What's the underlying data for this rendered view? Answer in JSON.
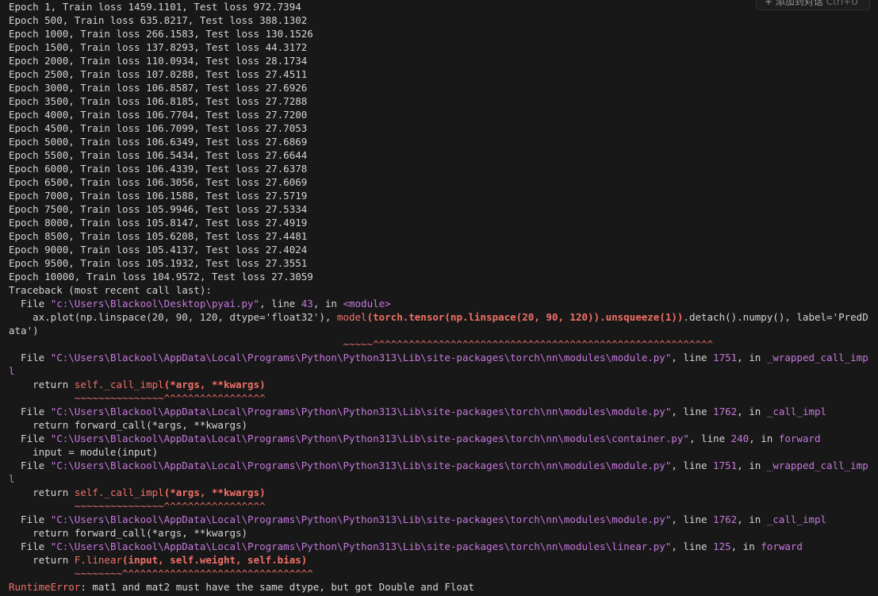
{
  "chat_chip": {
    "icon": "plus-icon",
    "label": "添加到对话",
    "shortcut": "Ctrl+U"
  },
  "epochs": [
    "Epoch 1, Train loss 1459.1101, Test loss 972.7394",
    "Epoch 500, Train loss 635.8217, Test loss 388.1302",
    "Epoch 1000, Train loss 266.1583, Test loss 130.1526",
    "Epoch 1500, Train loss 137.8293, Test loss 44.3172",
    "Epoch 2000, Train loss 110.0934, Test loss 28.1734",
    "Epoch 2500, Train loss 107.0288, Test loss 27.4511",
    "Epoch 3000, Train loss 106.8587, Test loss 27.6926",
    "Epoch 3500, Train loss 106.8185, Test loss 27.7288",
    "Epoch 4000, Train loss 106.7704, Test loss 27.7200",
    "Epoch 4500, Train loss 106.7099, Test loss 27.7053",
    "Epoch 5000, Train loss 106.6349, Test loss 27.6869",
    "Epoch 5500, Train loss 106.5434, Test loss 27.6644",
    "Epoch 6000, Train loss 106.4339, Test loss 27.6378",
    "Epoch 6500, Train loss 106.3056, Test loss 27.6069",
    "Epoch 7000, Train loss 106.1588, Test loss 27.5719",
    "Epoch 7500, Train loss 105.9946, Test loss 27.5334",
    "Epoch 8000, Train loss 105.8147, Test loss 27.4919",
    "Epoch 8500, Train loss 105.6208, Test loss 27.4481",
    "Epoch 9000, Train loss 105.4137, Test loss 27.4024",
    "Epoch 9500, Train loss 105.1932, Test loss 27.3551",
    "Epoch 10000, Train loss 104.9572, Test loss 27.3059"
  ],
  "traceback": {
    "header": "Traceback (most recent call last):",
    "frame0": {
      "file_prefix": "  File ",
      "path": "\"c:\\Users\\Blackool\\Desktop\\pyai.py\"",
      "line_word": ", line ",
      "line_no": "43",
      "in_word": ", in ",
      "func": "<module>",
      "code_a": "    ax.plot(np.linspace(20, 90, 120, dtype='float32'), ",
      "code_model": "model",
      "code_b": "(torch.tensor(np.linspace(20, 90, 120)).unsqueeze(1))",
      "code_c": ".detach().numpy(), label='PredD",
      "code_wrap": "ata')",
      "marker_indent": "                                                        ",
      "marker": "~~~~~^^^^^^^^^^^^^^^^^^^^^^^^^^^^^^^^^^^^^^^^^^^^^^^^^^^^^^^^^"
    },
    "frame1": {
      "path": "\"C:\\Users\\Blackool\\AppData\\Local\\Programs\\Python\\Python313\\Lib\\site-packages\\torch\\nn\\modules\\module.py\"",
      "line_no": "1751",
      "func": "_wrapped_call_imp",
      "func_wrap": "l",
      "ret_prefix": "    return ",
      "ret_head": "self._call_impl",
      "ret_args": "(*args, **kwargs)",
      "marker_indent": "           ",
      "marker": "~~~~~~~~~~~~~~~^^^^^^^^^^^^^^^^^"
    },
    "frame2": {
      "path": "\"C:\\Users\\Blackool\\AppData\\Local\\Programs\\Python\\Python313\\Lib\\site-packages\\torch\\nn\\modules\\module.py\"",
      "line_no": "1762",
      "func": "_call_impl",
      "code": "    return forward_call(*args, **kwargs)"
    },
    "frame3": {
      "path": "\"C:\\Users\\Blackool\\AppData\\Local\\Programs\\Python\\Python313\\Lib\\site-packages\\torch\\nn\\modules\\container.py\"",
      "line_no": "240",
      "func": "forward",
      "code": "    input = module(input)"
    },
    "frame4": {
      "path": "\"C:\\Users\\Blackool\\AppData\\Local\\Programs\\Python\\Python313\\Lib\\site-packages\\torch\\nn\\modules\\module.py\"",
      "line_no": "1751",
      "func": "_wrapped_call_imp",
      "func_wrap": "l",
      "ret_prefix": "    return ",
      "ret_head": "self._call_impl",
      "ret_args": "(*args, **kwargs)",
      "marker_indent": "           ",
      "marker": "~~~~~~~~~~~~~~~^^^^^^^^^^^^^^^^^"
    },
    "frame5": {
      "path": "\"C:\\Users\\Blackool\\AppData\\Local\\Programs\\Python\\Python313\\Lib\\site-packages\\torch\\nn\\modules\\module.py\"",
      "line_no": "1762",
      "func": "_call_impl",
      "code": "    return forward_call(*args, **kwargs)"
    },
    "frame6": {
      "path": "\"C:\\Users\\Blackool\\AppData\\Local\\Programs\\Python\\Python313\\Lib\\site-packages\\torch\\nn\\modules\\linear.py\"",
      "line_no": "125",
      "func": "forward",
      "ret_prefix": "    return ",
      "ret_head": "F.linear",
      "ret_args": "(input, self.weight, self.bias)",
      "marker_indent": "           ",
      "marker": "~~~~~~~~^^^^^^^^^^^^^^^^^^^^^^^^^^^^^^^^"
    },
    "error_type": "RuntimeError",
    "error_msg": ": mat1 and mat2 must have the same dtype, but got Double and Float"
  },
  "colors": {
    "background": "#181818",
    "text": "#d4d4d4",
    "path": "#c678dd",
    "error": "#f07167"
  }
}
